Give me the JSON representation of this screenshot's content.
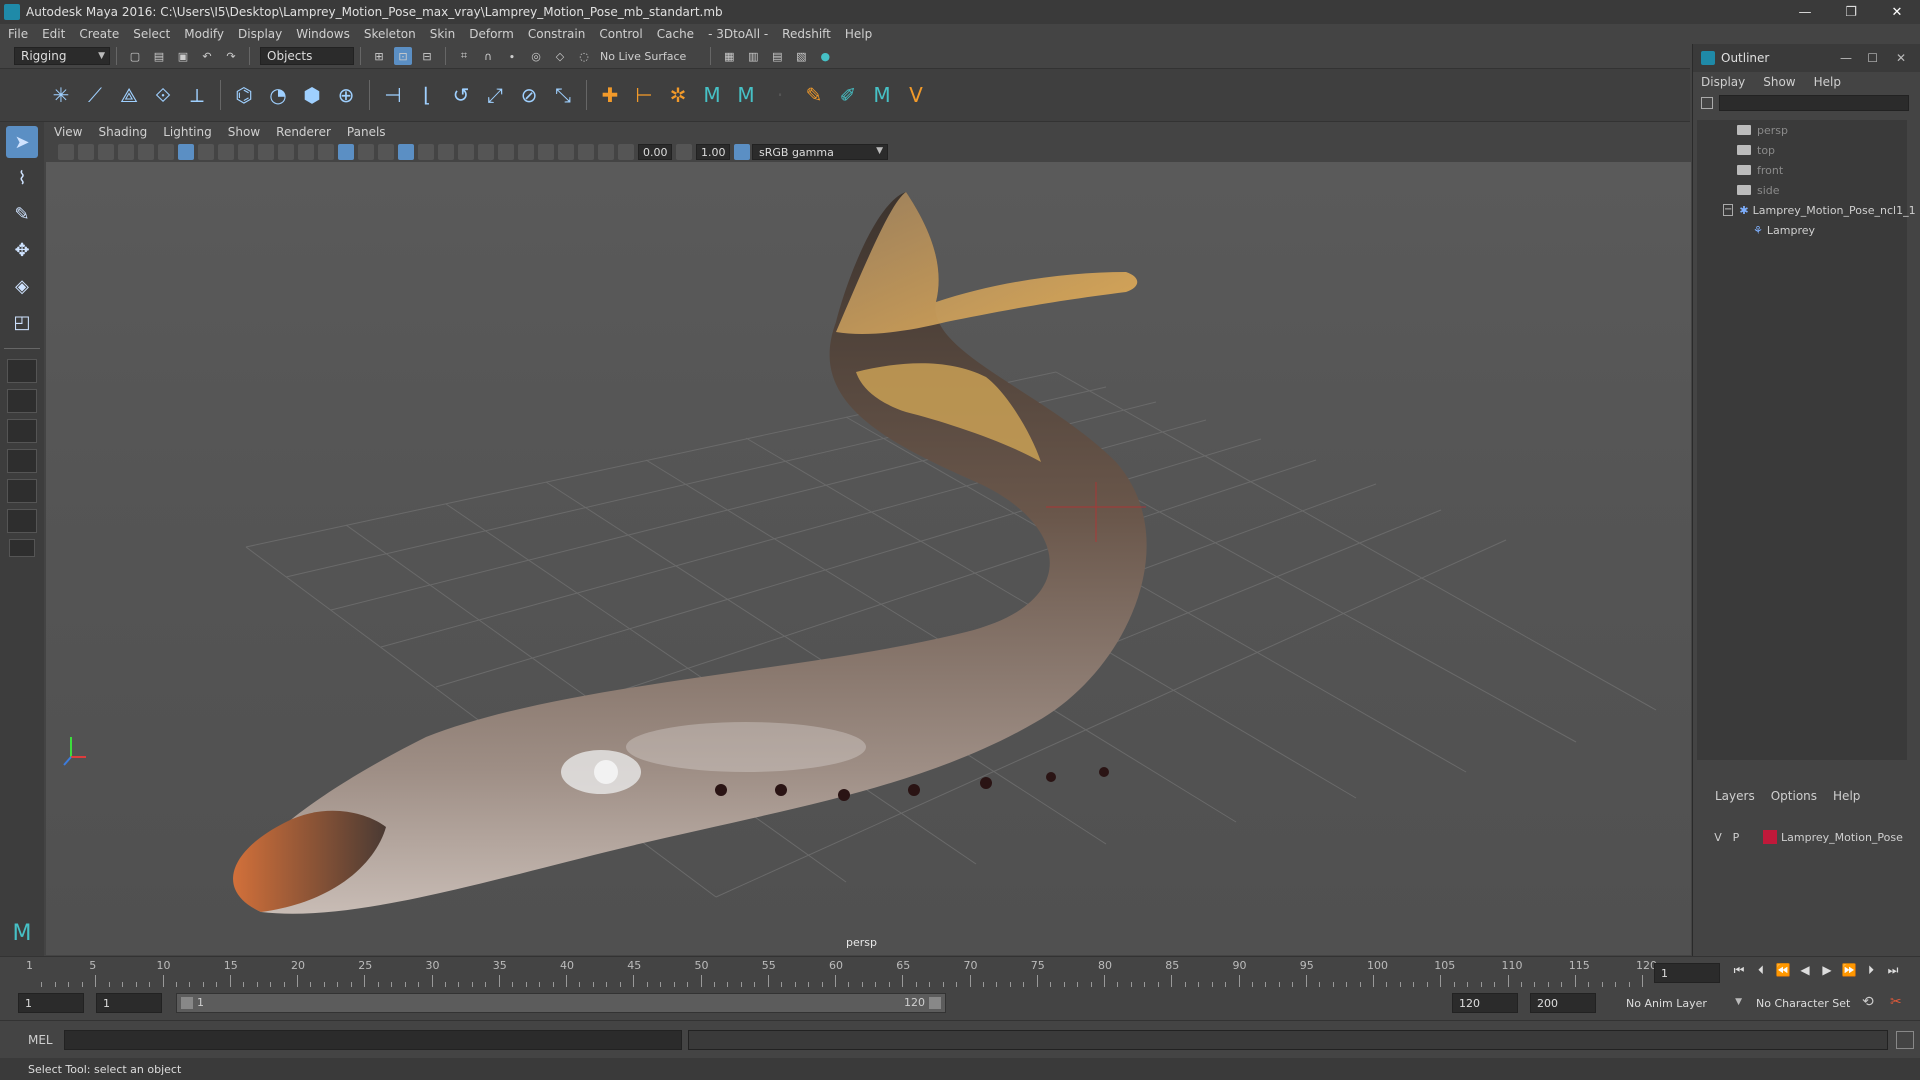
{
  "window": {
    "title": "Autodesk Maya 2016: C:\\Users\\I5\\Desktop\\Lamprey_Motion_Pose_max_vray\\Lamprey_Motion_Pose_mb_standart.mb",
    "minimize": "—",
    "restore": "❐",
    "close": "✕"
  },
  "menubar": [
    "File",
    "Edit",
    "Create",
    "Select",
    "Modify",
    "Display",
    "Windows",
    "Skeleton",
    "Skin",
    "Deform",
    "Constrain",
    "Control",
    "Cache",
    "- 3DtoAll -",
    "Redshift",
    "Help"
  ],
  "statusline": {
    "menuset": "Rigging",
    "select_mode": "Objects",
    "live_surface": "No Live Surface"
  },
  "viewport": {
    "menu": [
      "View",
      "Shading",
      "Lighting",
      "Show",
      "Renderer",
      "Panels"
    ],
    "field_a": "0.00",
    "field_b": "1.00",
    "colorspace": "sRGB gamma",
    "camera_label": "persp"
  },
  "outliner": {
    "title": "Outliner",
    "menu": [
      "Display",
      "Show",
      "Help"
    ],
    "cameras": [
      "persp",
      "top",
      "front",
      "side"
    ],
    "group": "Lamprey_Motion_Pose_ncl1_1",
    "child": "Lamprey"
  },
  "layers": {
    "menu": [
      "Layers",
      "Options",
      "Help"
    ],
    "row": {
      "v": "V",
      "p": "P",
      "name": "Lamprey_Motion_Pose"
    }
  },
  "timeline": {
    "ticks": [
      "5",
      "10",
      "15",
      "20",
      "25",
      "30",
      "35",
      "40",
      "45",
      "50",
      "55",
      "60",
      "65",
      "70",
      "75",
      "80",
      "85",
      "90",
      "95",
      "100",
      "105",
      "110",
      "115",
      "120"
    ],
    "start_marker": "1",
    "current_frame": "1"
  },
  "range": {
    "start": "1",
    "playback_start": "1",
    "range_start": "1",
    "range_end": "120",
    "end": "120",
    "anim_end": "200",
    "anim_layer": "No Anim Layer",
    "character_set": "No Character Set"
  },
  "command": {
    "label": "MEL"
  },
  "help": {
    "text": "Select Tool: select an object"
  }
}
